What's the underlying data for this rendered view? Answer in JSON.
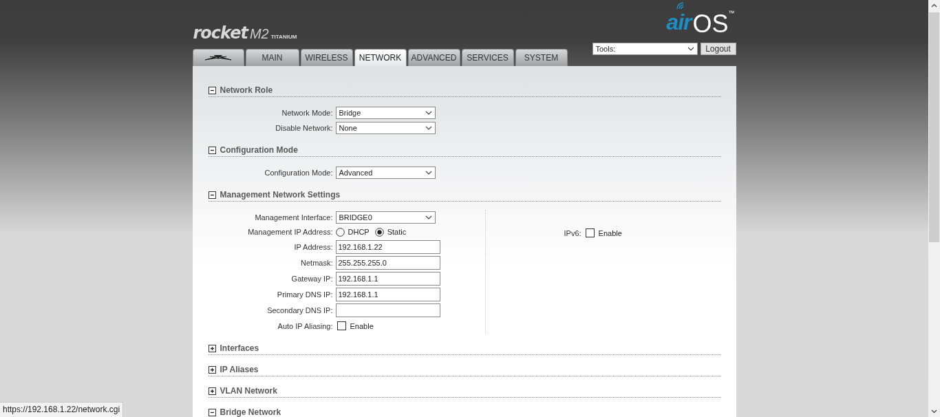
{
  "header": {
    "product": {
      "name": "rocket",
      "model": "M2",
      "edition": "TITANIUM"
    },
    "brand": {
      "prefix": "air",
      "name": "OS",
      "mark": "™"
    },
    "tools": {
      "value": "Tools:"
    },
    "logout": "Logout"
  },
  "tabs": [
    {
      "kind": "icon",
      "selected": false
    },
    {
      "kind": "text",
      "label": "MAIN",
      "selected": false
    },
    {
      "kind": "text",
      "label": "WIRELESS",
      "selected": false
    },
    {
      "kind": "text",
      "label": "NETWORK",
      "selected": true
    },
    {
      "kind": "text",
      "label": "ADVANCED",
      "selected": false
    },
    {
      "kind": "text",
      "label": "SERVICES",
      "selected": false
    },
    {
      "kind": "text",
      "label": "SYSTEM",
      "selected": false
    }
  ],
  "sections": [
    {
      "title": "Network Role",
      "expanded": true,
      "fields": [
        {
          "kind": "select",
          "label": "Network Mode:",
          "value": "Bridge"
        },
        {
          "kind": "select",
          "label": "Disable Network:",
          "value": "None"
        }
      ]
    },
    {
      "title": "Configuration Mode",
      "expanded": true,
      "fields": [
        {
          "kind": "select",
          "label": "Configuration Mode:",
          "value": "Advanced"
        }
      ]
    },
    {
      "title": "Management Network Settings",
      "expanded": true,
      "fields": [
        {
          "kind": "select",
          "label": "Management Interface:",
          "value": "BRIDGE0"
        },
        {
          "kind": "radio",
          "label": "Management IP Address:",
          "options": [
            {
              "label": "DHCP",
              "selected": false
            },
            {
              "label": "Static",
              "selected": true
            }
          ]
        },
        {
          "kind": "text",
          "label": "IP Address:",
          "value": "192.168.1.22"
        },
        {
          "kind": "text",
          "label": "Netmask:",
          "value": "255.255.255.0"
        },
        {
          "kind": "text",
          "label": "Gateway IP:",
          "value": "192.168.1.1"
        },
        {
          "kind": "text",
          "label": "Primary DNS IP:",
          "value": "192.168.1.1"
        },
        {
          "kind": "text",
          "label": "Secondary DNS IP:"
        },
        {
          "kind": "checkbox",
          "label": "Auto IP Aliasing:",
          "option": "Enable",
          "checked": false
        }
      ],
      "side_fields": [
        {
          "kind": "checkbox",
          "label": "IPv6:",
          "option": "Enable",
          "checked": false
        }
      ]
    },
    {
      "title": "Interfaces",
      "expanded": false
    },
    {
      "title": "IP Aliases",
      "expanded": false
    },
    {
      "title": "VLAN Network",
      "expanded": false
    },
    {
      "title": "Bridge Network",
      "expanded": true
    }
  ],
  "status_bar": {
    "url": "https://192.168.1.22/network.cgi"
  }
}
